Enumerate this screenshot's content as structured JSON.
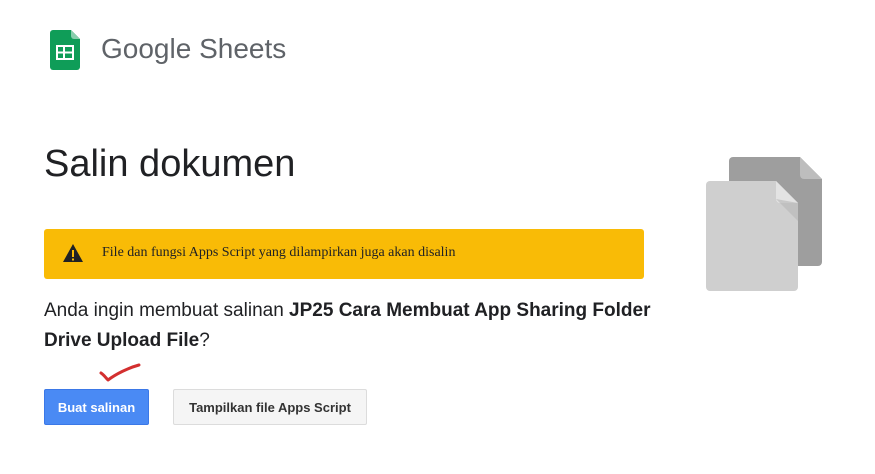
{
  "brand": {
    "name": "Google Sheets",
    "color": "#5f6368",
    "icon": "google-sheets-icon",
    "icon_color": "#0f9d58"
  },
  "page": {
    "title": "Salin dokumen"
  },
  "warning": {
    "icon": "warning-icon",
    "text": "File dan fungsi Apps Script yang dilampirkan juga akan disalin",
    "background": "#f9bb06"
  },
  "question": {
    "prefix": "Anda ingin membuat salinan ",
    "document_name": "JP25 Cara Membuat App Sharing Folder Drive Upload File",
    "suffix": "?"
  },
  "actions": {
    "primary_label": "Buat salinan",
    "primary_color": "#4a8af4",
    "secondary_label": "Tampilkan file Apps Script"
  },
  "illustration": {
    "icon": "copy-documents-icon"
  }
}
